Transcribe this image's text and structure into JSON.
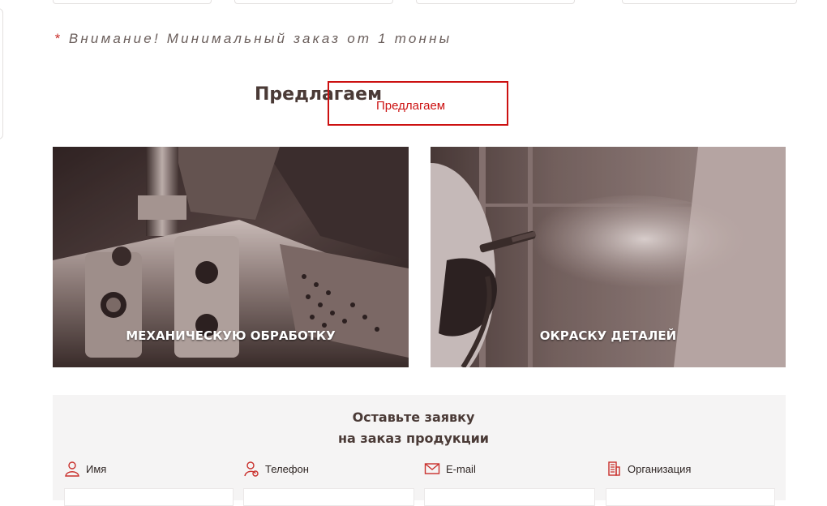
{
  "notice": {
    "star": "*",
    "text": "Внимание! Минимальный заказ от 1 тонны"
  },
  "section": {
    "title": "Предлагаем",
    "overlay_label": "Предлагаем"
  },
  "services": [
    {
      "label": "МЕХАНИЧЕСКУЮ ОБРАБОТКУ",
      "image": "machining-photo"
    },
    {
      "label": "ОКРАСКУ ДЕТАЛЕЙ",
      "image": "painting-photo"
    }
  ],
  "form": {
    "title_line1": "Оставьте заявку",
    "title_line2": "на заказ продукции",
    "fields": [
      {
        "label": "Имя",
        "icon": "user-icon"
      },
      {
        "label": "Телефон",
        "icon": "phone-user-icon"
      },
      {
        "label": "E-mail",
        "icon": "envelope-icon"
      },
      {
        "label": "Организация",
        "icon": "building-icon"
      }
    ]
  },
  "colors": {
    "accent": "#c9302c",
    "overlay": "#cc1111",
    "text": "#4a3a36",
    "panel": "#f5f4f4"
  }
}
